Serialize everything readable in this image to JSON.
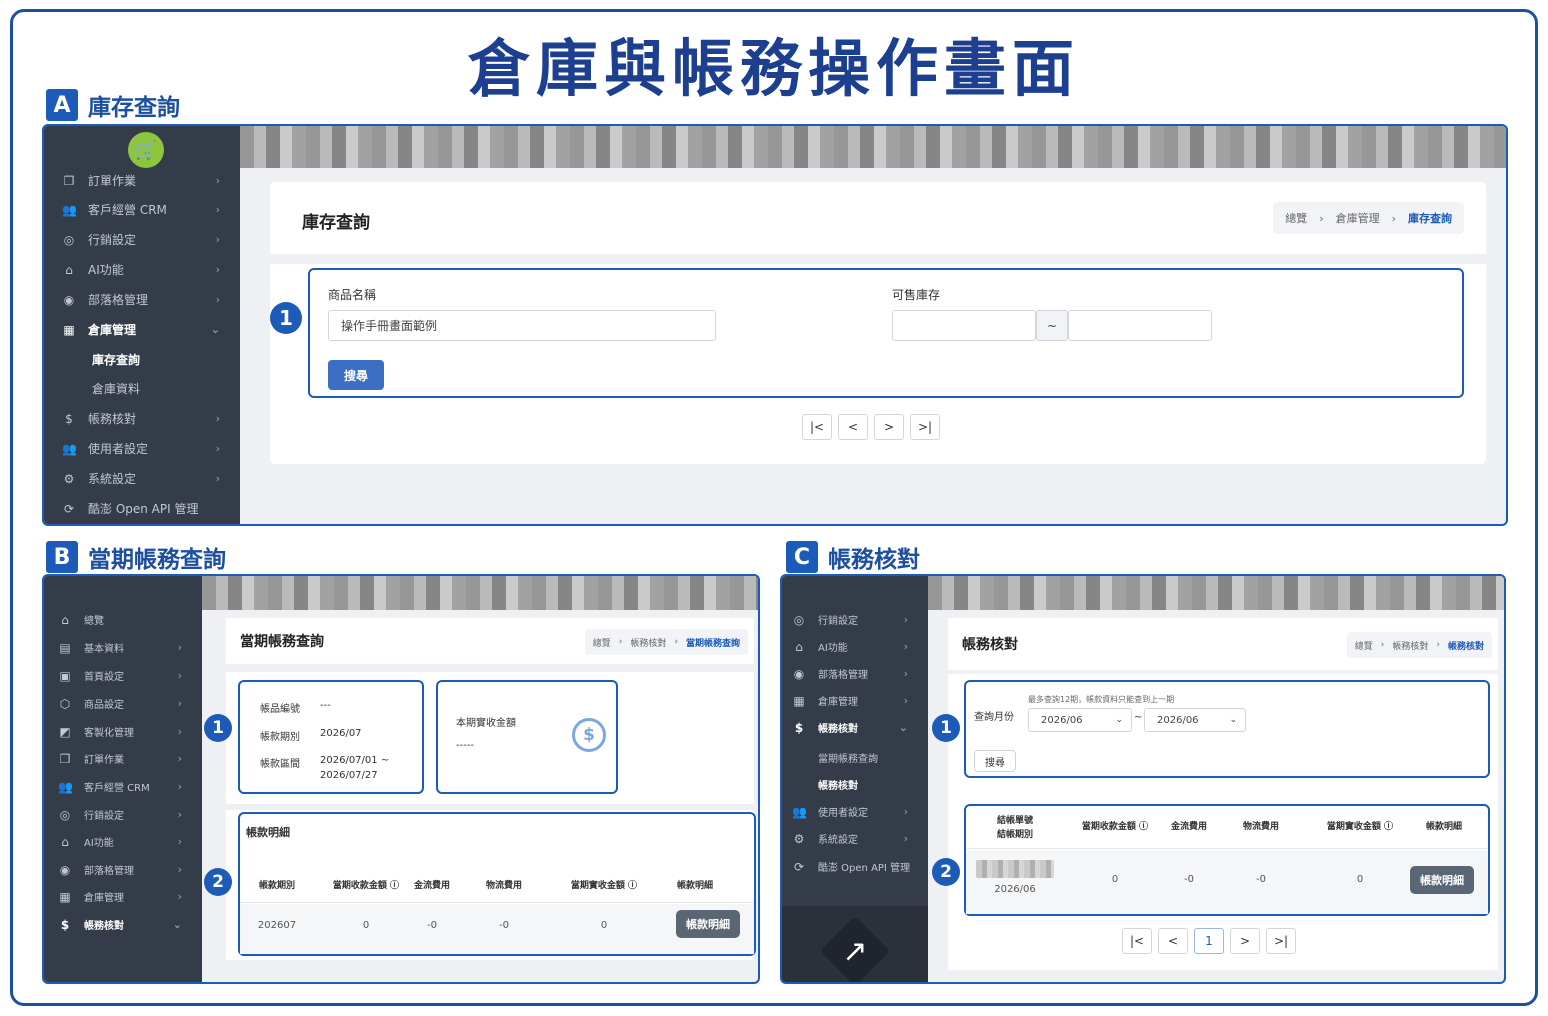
{
  "title": "倉庫與帳務操作畫面",
  "sections": {
    "a": {
      "badge": "A",
      "label": "庫存查詢"
    },
    "b": {
      "badge": "B",
      "label": "當期帳務查詢"
    },
    "c": {
      "badge": "C",
      "label": "帳務核對"
    }
  },
  "panel_a": {
    "sidebar": [
      {
        "label": "訂單作業",
        "icon": "copy-icon"
      },
      {
        "label": "客戶經營 CRM",
        "icon": "users-icon"
      },
      {
        "label": "行銷設定",
        "icon": "target-icon"
      },
      {
        "label": "AI功能",
        "icon": "robot-icon"
      },
      {
        "label": "部落格管理",
        "icon": "circle-icon"
      },
      {
        "label": "倉庫管理",
        "icon": "grid-icon"
      },
      {
        "label": "帳務核對",
        "icon": "dollar-icon"
      },
      {
        "label": "使用者設定",
        "icon": "users-cog-icon"
      },
      {
        "label": "系統設定",
        "icon": "gear-icon"
      },
      {
        "label": "酷澎 Open API 管理",
        "icon": "api-icon"
      }
    ],
    "submenu": [
      "庫存查詢",
      "倉庫資料"
    ],
    "page_title": "庫存查詢",
    "breadcrumb": [
      "總覽",
      "倉庫管理",
      "庫存查詢"
    ],
    "form": {
      "product_label": "商品名稱",
      "product_value": "操作手冊畫面範例",
      "stock_label": "可售庫存",
      "range_sep": "~",
      "search": "搜尋"
    },
    "pager": [
      "|<",
      "<",
      ">",
      ">|"
    ],
    "marker": "1"
  },
  "panel_b": {
    "sidebar": [
      {
        "label": "總覽",
        "icon": "home-icon"
      },
      {
        "label": "基本資料",
        "icon": "card-icon"
      },
      {
        "label": "首頁設定",
        "icon": "layout-icon"
      },
      {
        "label": "商品設定",
        "icon": "box-icon"
      },
      {
        "label": "客製化管理",
        "icon": "custom-icon"
      },
      {
        "label": "訂單作業",
        "icon": "copy-icon"
      },
      {
        "label": "客戶經營 CRM",
        "icon": "users-icon"
      },
      {
        "label": "行銷設定",
        "icon": "target-icon"
      },
      {
        "label": "AI功能",
        "icon": "robot-icon"
      },
      {
        "label": "部落格管理",
        "icon": "circle-icon"
      },
      {
        "label": "倉庫管理",
        "icon": "grid-icon"
      },
      {
        "label": "帳務核對",
        "icon": "dollar-icon"
      }
    ],
    "page_title": "當期帳務查詢",
    "breadcrumb": [
      "總覽",
      "帳務核對",
      "當期帳務查詢"
    ],
    "info": {
      "code_label": "帳品編號",
      "code_value": "---",
      "period_label": "帳款期別",
      "period_value": "2026/07",
      "range_label": "帳款區間",
      "range_value_1": "2026/07/01 ~",
      "range_value_2": "2026/07/27",
      "amount_label": "本期實收金額",
      "amount_value": "-----"
    },
    "detail_title": "帳款明細",
    "table_headers": [
      "帳款期別",
      "當期收款金額 ⓘ",
      "金流費用",
      "物流費用",
      "當期實收金額 ⓘ",
      "帳款明細"
    ],
    "table_row": [
      "202607",
      "0",
      "-0",
      "-0",
      "0"
    ],
    "detail_button": "帳款明細",
    "markers": [
      "1",
      "2"
    ]
  },
  "panel_c": {
    "sidebar": [
      {
        "label": "行銷設定",
        "icon": "target-icon"
      },
      {
        "label": "AI功能",
        "icon": "robot-icon"
      },
      {
        "label": "部落格管理",
        "icon": "circle-icon"
      },
      {
        "label": "倉庫管理",
        "icon": "grid-icon"
      },
      {
        "label": "帳務核對",
        "icon": "dollar-icon"
      },
      {
        "label": "使用者設定",
        "icon": "users-cog-icon"
      },
      {
        "label": "系統設定",
        "icon": "gear-icon"
      },
      {
        "label": "酷澎 Open API 管理",
        "icon": "api-icon"
      }
    ],
    "submenu": [
      "當期帳務查詢",
      "帳務核對"
    ],
    "page_title": "帳務核對",
    "breadcrumb": [
      "總覽",
      "帳務核對",
      "帳務核對"
    ],
    "form": {
      "month_label": "查詢月份",
      "hint": "最多查詢12期，帳款資料只能查到上一期",
      "from": "2026/06",
      "to": "2026/06",
      "sep": "~",
      "search": "搜尋"
    },
    "table_headers": [
      "結帳單號\n結帳期別",
      "當期收款金額 ⓘ",
      "金流費用",
      "物流費用",
      "當期實收金額 ⓘ",
      "帳款明細"
    ],
    "table_row": {
      "period": "2026/06",
      "values": [
        "0",
        "-0",
        "-0",
        "0"
      ]
    },
    "detail_button": "帳款明細",
    "pager": [
      "|<",
      "<",
      "1",
      ">",
      ">|"
    ],
    "markers": [
      "1",
      "2"
    ]
  }
}
